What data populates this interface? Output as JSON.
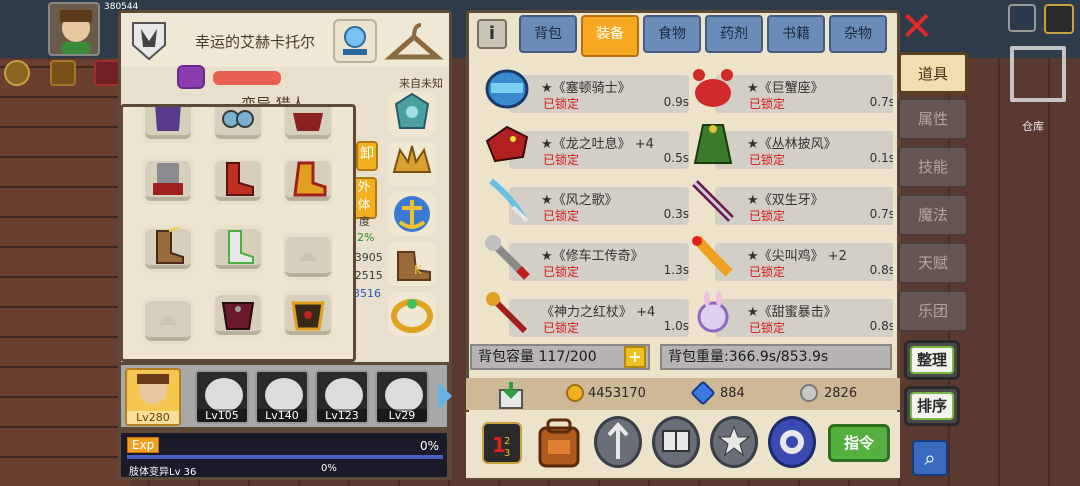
{
  "character": {
    "name": "幸运的艾赫卡托尔",
    "origin": "来自未知",
    "class_partial": "变异 猎人",
    "stats_partial": [
      "卸",
      "外\n体",
      "度",
      "2%",
      "/3905",
      "/2515",
      "3516"
    ],
    "hp_partial": "380544"
  },
  "equip_popup_slots": [
    {
      "icon": "purple-cloak-icon"
    },
    {
      "icon": "blue-goggles-icon"
    },
    {
      "icon": "red-armor-icon"
    },
    {
      "icon": "gray-gauntlet-icon"
    },
    {
      "icon": "red-boots-icon"
    },
    {
      "icon": "gold-red-boots-icon"
    },
    {
      "icon": "feather-boots-icon"
    },
    {
      "icon": "silver-boots-icon"
    },
    {
      "icon": "empty-slot-icon"
    },
    {
      "icon": "empty-slot-icon"
    },
    {
      "icon": "dark-armor-icon"
    },
    {
      "icon": "gold-armor-icon"
    }
  ],
  "equip_column": [
    {
      "icon": "crystal-amulet-icon"
    },
    {
      "icon": "gold-crown-icon"
    },
    {
      "icon": "anchor-icon"
    },
    {
      "icon": "k-boots-icon"
    },
    {
      "icon": "gold-ring-icon"
    }
  ],
  "party": [
    {
      "level": "Lv280",
      "selected": true
    },
    {
      "level": "Lv105",
      "selected": false
    },
    {
      "level": "Lv140",
      "selected": false
    },
    {
      "level": "Lv123",
      "selected": false
    },
    {
      "level": "Lv29",
      "selected": false
    }
  ],
  "exp": {
    "label": "Exp",
    "percent": "0%",
    "sub_label": "肢体变异Lv 36",
    "sub_percent": "0%"
  },
  "tabs": [
    "背包",
    "装备",
    "食物",
    "药剂",
    "书籍",
    "杂物"
  ],
  "active_tab": "装备",
  "items": [
    {
      "name": "★《塞顿骑士》",
      "lock": "已锁定",
      "weight": "0.9s",
      "icon": "blue-helmet-icon"
    },
    {
      "name": "★《巨蟹座》",
      "lock": "已锁定",
      "weight": "0.7s",
      "icon": "crab-armor-icon"
    },
    {
      "name": "★《龙之吐息》 +4",
      "lock": "已锁定",
      "weight": "0.5s",
      "icon": "dragon-head-icon"
    },
    {
      "name": "★《丛林披风》",
      "lock": "已锁定",
      "weight": "0.1s",
      "icon": "green-cloak-icon"
    },
    {
      "name": "★《风之歌》",
      "lock": "已锁定",
      "weight": "0.3s",
      "icon": "wind-blade-icon"
    },
    {
      "name": "★《双生牙》",
      "lock": "已锁定",
      "weight": "0.7s",
      "icon": "twin-sword-icon"
    },
    {
      "name": "★《修车工传奇》",
      "lock": "已锁定",
      "weight": "1.3s",
      "icon": "wrench-icon"
    },
    {
      "name": "★《尖叫鸡》 +2",
      "lock": "已锁定",
      "weight": "0.8s",
      "icon": "rubber-chicken-icon"
    },
    {
      "name": "《神力之红杖》 +4",
      "lock": "已锁定",
      "weight": "1.0s",
      "icon": "red-staff-icon"
    },
    {
      "name": "★《甜蜜暴击》",
      "lock": "已锁定",
      "weight": "0.8s",
      "icon": "bunny-ring-icon"
    }
  ],
  "capacity": {
    "label": "背包容量",
    "value": "117/200"
  },
  "weight": {
    "label": "背包重量:",
    "value": "366.9s/853.9s"
  },
  "currency": {
    "gold": "4453170",
    "diamond": "884",
    "silver": "2826"
  },
  "command_label": "指令",
  "side_tabs": [
    "道具",
    "属性",
    "技能",
    "魔法",
    "天赋",
    "乐团"
  ],
  "active_side_tab": "道具",
  "sort_buttons": [
    "整理",
    "排序"
  ],
  "warehouse_label": "仓库",
  "colors": {
    "active_tab": "#f6a820",
    "tab": "#6c8cb8",
    "locked": "#d41a1a",
    "panel": "#ede3ca"
  }
}
